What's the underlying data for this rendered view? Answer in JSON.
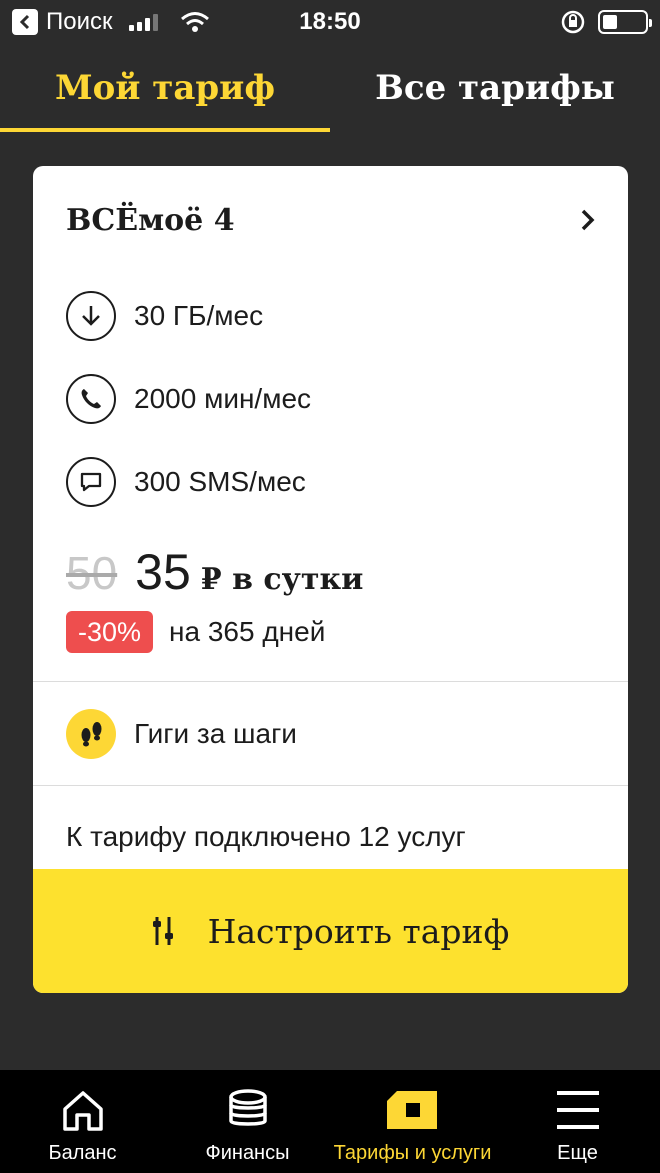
{
  "statusbar": {
    "back_label": "Поиск",
    "time": "18:50"
  },
  "tabs": [
    {
      "label": "Мой тариф",
      "active": true
    },
    {
      "label": "Все тарифы",
      "active": false
    }
  ],
  "card": {
    "plan_name": "ВСЁмоё 4",
    "features": [
      {
        "icon": "download-arrow-icon",
        "text": "30 ГБ/мес"
      },
      {
        "icon": "phone-icon",
        "text": "2000 мин/мес"
      },
      {
        "icon": "sms-bubble-icon",
        "text": "300 SMS/мес"
      }
    ],
    "old_price": "50",
    "new_price": "35",
    "price_unit": "₽ в сутки",
    "discount_badge": "-30%",
    "discount_text": "на 365 дней",
    "gigi_label": "Гиги за шаги",
    "services_text": "К тарифу подключено 12 услуг",
    "setup_button": "Настроить тариф"
  },
  "colors": {
    "accent": "#fdd735",
    "button": "#fde12e",
    "badge": "#ee4e4e",
    "background": "#2c2c2c"
  },
  "nav": [
    {
      "label": "Баланс",
      "icon": "home-icon",
      "active": false
    },
    {
      "label": "Финансы",
      "icon": "coins-stack-icon",
      "active": false
    },
    {
      "label": "Тарифы и услуги",
      "icon": "sim-card-icon",
      "active": true
    },
    {
      "label": "Еще",
      "icon": "menu-icon",
      "active": false
    }
  ]
}
